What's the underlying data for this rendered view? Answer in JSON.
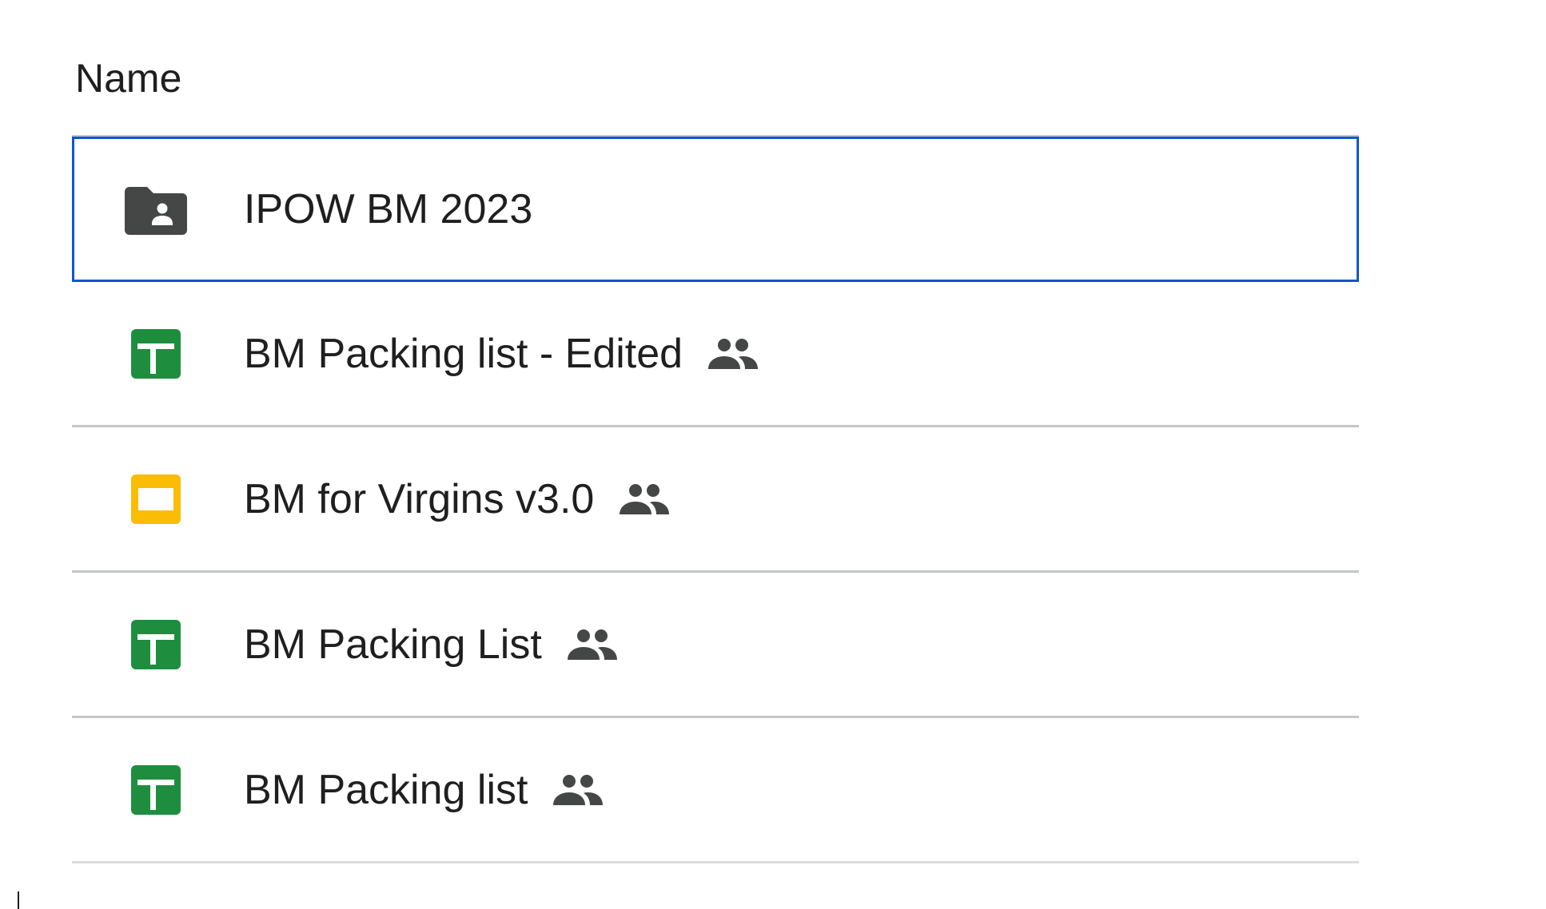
{
  "header": {
    "name_label": "Name"
  },
  "files": [
    {
      "name": "IPOW BM 2023",
      "icon": "shared-folder-icon",
      "shared": false,
      "selected": true
    },
    {
      "name": "BM Packing list - Edited",
      "icon": "google-sheets-icon",
      "shared": true,
      "selected": false
    },
    {
      "name": "BM for Virgins v3.0",
      "icon": "google-slides-icon",
      "shared": true,
      "selected": false
    },
    {
      "name": "BM Packing List",
      "icon": "google-sheets-icon",
      "shared": true,
      "selected": false
    },
    {
      "name": "BM Packing list",
      "icon": "google-sheets-icon",
      "shared": true,
      "selected": false
    }
  ],
  "colors": {
    "selection_border": "#0b57d0",
    "sheets_green": "#1e8e3e",
    "slides_yellow": "#fbbc04",
    "folder_gray": "#444746",
    "divider": "#c4c7c5"
  }
}
